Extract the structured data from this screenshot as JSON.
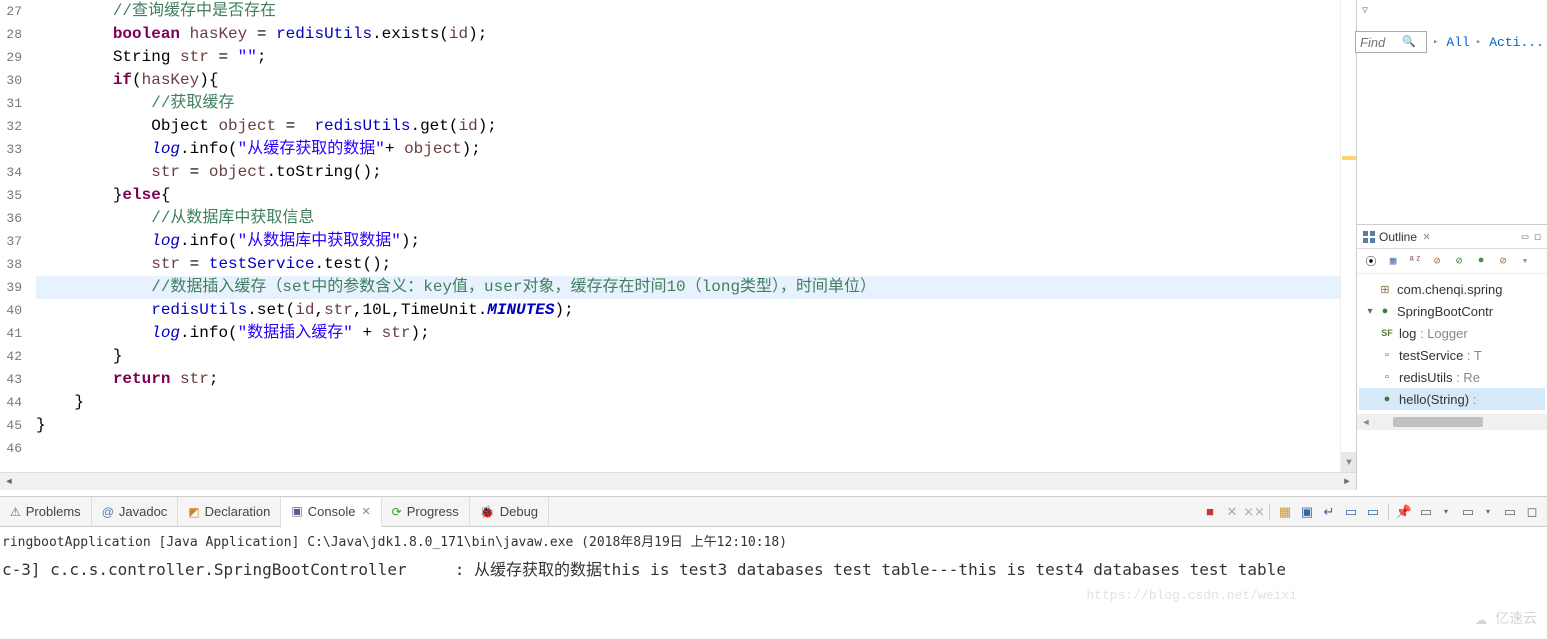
{
  "gutter": {
    "start": 27,
    "end": 46
  },
  "code": {
    "l27_comment": "//查询缓存中是否存在",
    "l28_1": "boolean",
    "l28_2": "hasKey",
    "l28_3": " = ",
    "l28_4": "redisUtils",
    "l28_5": ".exists(",
    "l28_6": "id",
    "l28_7": ");",
    "l29_1": "String ",
    "l29_2": "str",
    "l29_3": " = ",
    "l29_4": "\"\"",
    "l29_5": ";",
    "l30_1": "if",
    "l30_2": "(",
    "l30_3": "hasKey",
    "l30_4": "){",
    "l31_comment": "//获取缓存",
    "l32_1": "Object ",
    "l32_2": "object",
    "l32_3": " =  ",
    "l32_4": "redisUtils",
    "l32_5": ".get(",
    "l32_6": "id",
    "l32_7": ");",
    "l33_1": "log",
    "l33_2": ".info(",
    "l33_3": "\"从缓存获取的数据\"",
    "l33_4": "+ ",
    "l33_5": "object",
    "l33_6": ");",
    "l34_1": "str",
    "l34_2": " = ",
    "l34_3": "object",
    "l34_4": ".toString();",
    "l35_1": "}",
    "l35_2": "else",
    "l35_3": "{",
    "l36_comment": "//从数据库中获取信息",
    "l37_1": "log",
    "l37_2": ".info(",
    "l37_3": "\"从数据库中获取数据\"",
    "l37_4": ");",
    "l38_1": "str",
    "l38_2": " = ",
    "l38_3": "testService",
    "l38_4": ".test();",
    "l39_comment": "//数据插入缓存（set中的参数含义：key值，user对象，缓存存在时间10（long类型），时间单位）",
    "l40_1": "redisUtils",
    "l40_2": ".set(",
    "l40_3": "id",
    "l40_4": ",",
    "l40_5": "str",
    "l40_6": ",10L,TimeUnit.",
    "l40_7": "MINUTES",
    "l40_8": ");",
    "l41_1": "log",
    "l41_2": ".info(",
    "l41_3": "\"数据插入缓存\"",
    "l41_4": " + ",
    "l41_5": "str",
    "l41_6": ");",
    "l42_1": "}",
    "l43_1": "return",
    "l43_2": " ",
    "l43_3": "str",
    "l43_4": ";",
    "l44_1": "}",
    "l45_1": "}"
  },
  "find": {
    "placeholder": "Find",
    "all_label": "All",
    "acti_label": "Acti..."
  },
  "outline": {
    "title": "Outline",
    "items": {
      "pkg": "com.chenqi.spring",
      "cls": "SpringBootContr",
      "log_name": "log",
      "log_type": " : Logger",
      "test_name": "testService",
      "test_type": " : T",
      "redis_name": "redisUtils",
      "redis_type": " : Re",
      "hello_name": "hello(String)",
      "hello_type": " : "
    }
  },
  "tabs": {
    "problems": "Problems",
    "javadoc": "Javadoc",
    "declaration": "Declaration",
    "console": "Console",
    "progress": "Progress",
    "debug": "Debug"
  },
  "console": {
    "launch": "ringbootApplication [Java Application] C:\\Java\\jdk1.8.0_171\\bin\\javaw.exe (2018年8月19日 上午12:10:18)",
    "output_prefix": "c-3] c.c.s.controller.SpringBootController     : ",
    "output_msg": "从缓存获取的数据this is test3 databases test table---this is test4 databases test table"
  },
  "watermark": {
    "url": "https://blog.csdn.net/weixi",
    "brand": "亿速云"
  }
}
